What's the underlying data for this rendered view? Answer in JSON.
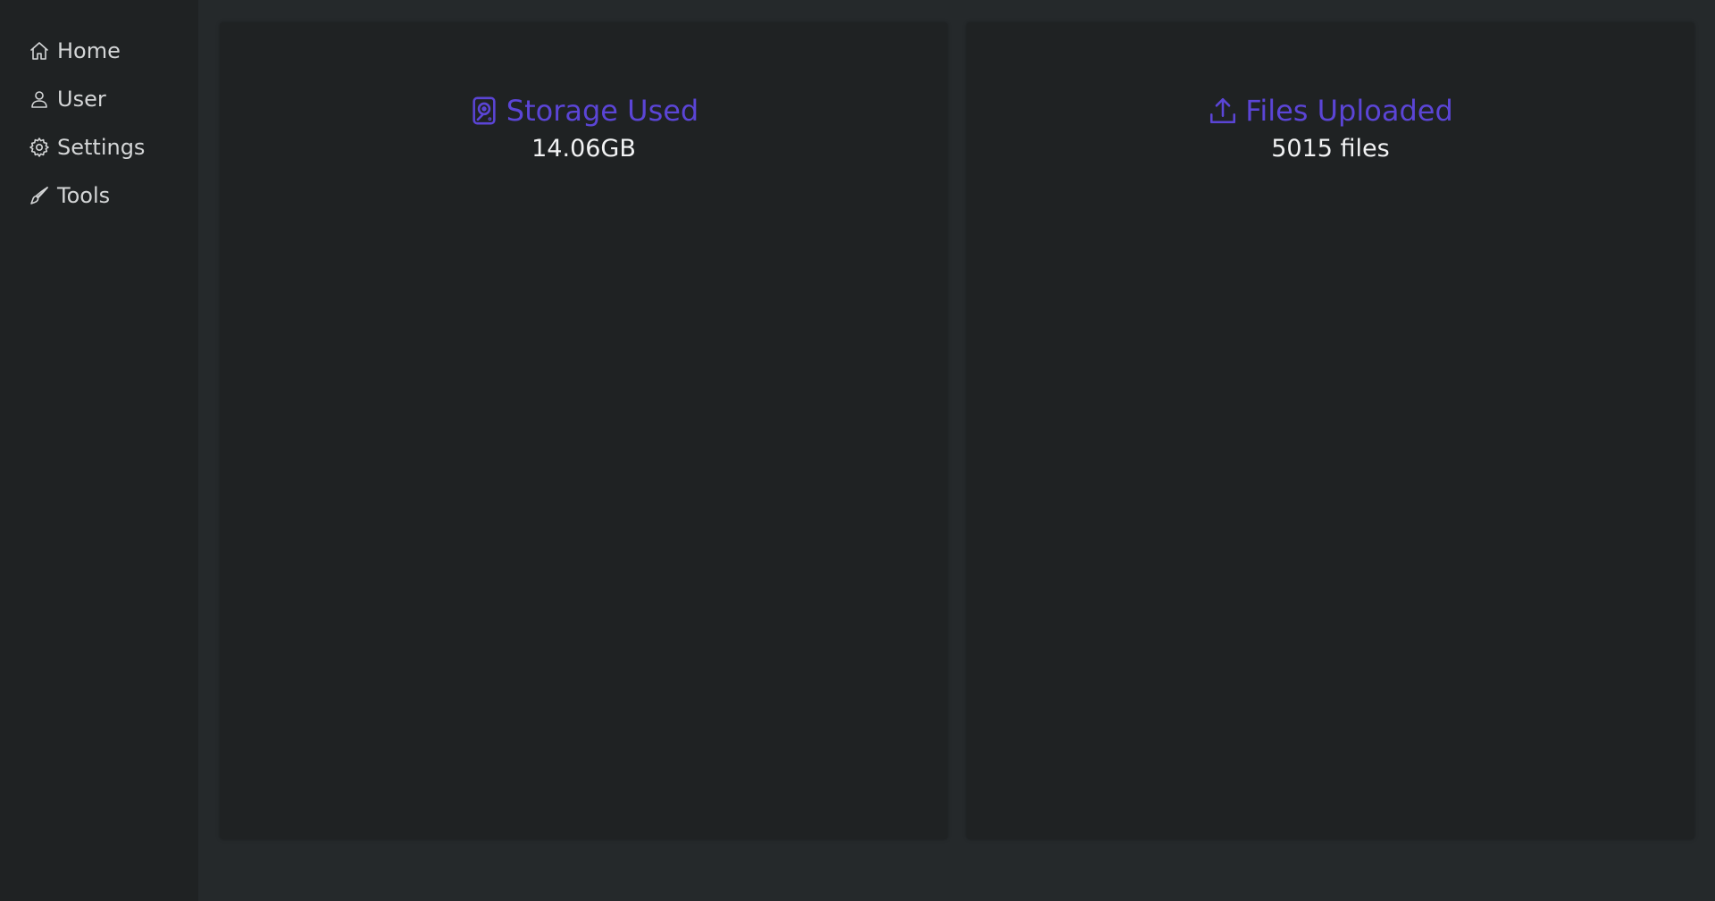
{
  "sidebar": {
    "items": [
      {
        "label": "Home",
        "icon": "home-icon"
      },
      {
        "label": "User",
        "icon": "user-icon"
      },
      {
        "label": "Settings",
        "icon": "gear-icon"
      },
      {
        "label": "Tools",
        "icon": "brush-icon"
      }
    ]
  },
  "cards": {
    "storage": {
      "title": "Storage Used",
      "value": "14.06GB",
      "icon": "hard-drive-icon"
    },
    "files": {
      "title": "Files Uploaded",
      "value": "5015 files",
      "icon": "upload-icon"
    }
  },
  "colors": {
    "accent": "#5b45d6",
    "background": "#25292b",
    "panel": "#1f2223",
    "text": "#d4d6d7"
  }
}
